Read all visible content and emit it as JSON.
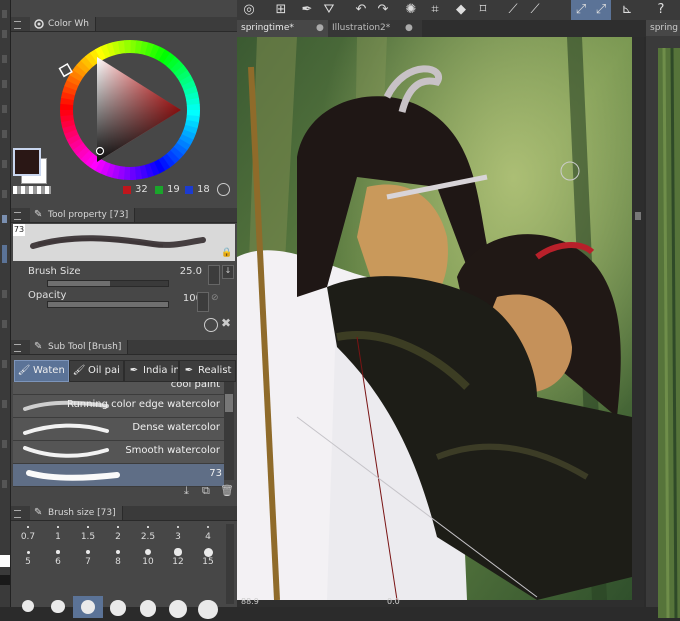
{
  "color_panel": {
    "tab_label": "Color Wh",
    "r": "32",
    "g": "19",
    "b": "18"
  },
  "tool_property": {
    "tab_label": "Tool property [73]",
    "preset_number": "73",
    "brush_size_label": "Brush Size",
    "brush_size_value": "25.0",
    "brush_size_fraction": 0.52,
    "opacity_label": "Opacity",
    "opacity_value": "100",
    "opacity_fraction": 1.0
  },
  "sub_tool": {
    "tab_label": "Sub Tool [Brush]",
    "tabs": [
      {
        "label": "Waten",
        "active": true
      },
      {
        "label": "Oil pai",
        "active": false
      },
      {
        "label": "India in",
        "active": false
      },
      {
        "label": "Realist",
        "active": false
      }
    ],
    "brushes": [
      {
        "name": "cool paint"
      },
      {
        "name": "Running color edge watercolor"
      },
      {
        "name": "Dense watercolor"
      },
      {
        "name": "Smooth watercolor"
      },
      {
        "name": "73"
      }
    ]
  },
  "brush_size_panel": {
    "tab_label": "Brush size [73]",
    "row1": [
      "0.7",
      "1",
      "1.5",
      "2",
      "2.5",
      "3",
      "4"
    ],
    "row2": [
      "5",
      "6",
      "7",
      "8",
      "10",
      "12",
      "15"
    ]
  },
  "document_tabs": [
    {
      "label": "springtime*",
      "active": true
    },
    {
      "label": "Illustration2*",
      "active": false
    }
  ],
  "right_panel_tab": "spring",
  "status": {
    "zoom": "88.9",
    "angle": "0.0"
  },
  "colors": {
    "main_color": "#2a1715",
    "sub_color": "#ffffff",
    "accent": "#5b7397"
  }
}
